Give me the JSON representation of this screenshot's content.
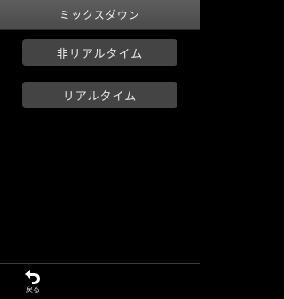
{
  "header": {
    "title": "ミックスダウン"
  },
  "menu": {
    "items": [
      {
        "label": "非リアルタイム"
      },
      {
        "label": "リアルタイム"
      }
    ]
  },
  "footer": {
    "back_label": "戻る",
    "back_icon": "back-arrow-icon"
  },
  "colors": {
    "background": "#000000",
    "header": "#555555",
    "button": "#444444",
    "text": "#ffffff"
  }
}
